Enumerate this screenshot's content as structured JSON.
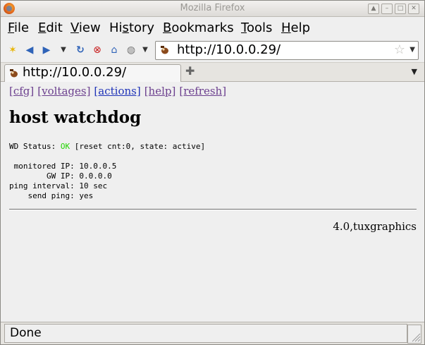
{
  "window": {
    "title": "Mozilla Firefox"
  },
  "menu": {
    "items": [
      {
        "accel": "F",
        "rest": "ile"
      },
      {
        "accel": "E",
        "rest": "dit"
      },
      {
        "accel": "V",
        "rest": "iew"
      },
      {
        "pre": "Hi",
        "accel": "s",
        "rest": "tory"
      },
      {
        "accel": "B",
        "rest": "ookmarks"
      },
      {
        "accel": "T",
        "rest": "ools"
      },
      {
        "accel": "H",
        "rest": "elp"
      }
    ]
  },
  "navbar": {
    "url": "http://10.0.0.29/"
  },
  "tabs": [
    {
      "label": "http://10.0.0.29/"
    }
  ],
  "page": {
    "links": [
      "[cfg]",
      "[voltages]",
      "[actions]",
      "[help]",
      "[refresh]"
    ],
    "heading": "host watchdog",
    "status": {
      "label": "WD Status: ",
      "ok": "OK",
      "detail": " [reset cnt:0, state: active]"
    },
    "info": [
      " monitored IP: 10.0.0.5",
      "        GW IP: 0.0.0.0",
      "ping interval: 10 sec",
      "    send ping: yes"
    ],
    "version": "4.0,tuxgraphics"
  },
  "statusbar": {
    "text": "Done"
  },
  "colors": {
    "ok": "#22d400",
    "visited_link": "#6b3f8e",
    "active_link": "#1f33b8"
  }
}
